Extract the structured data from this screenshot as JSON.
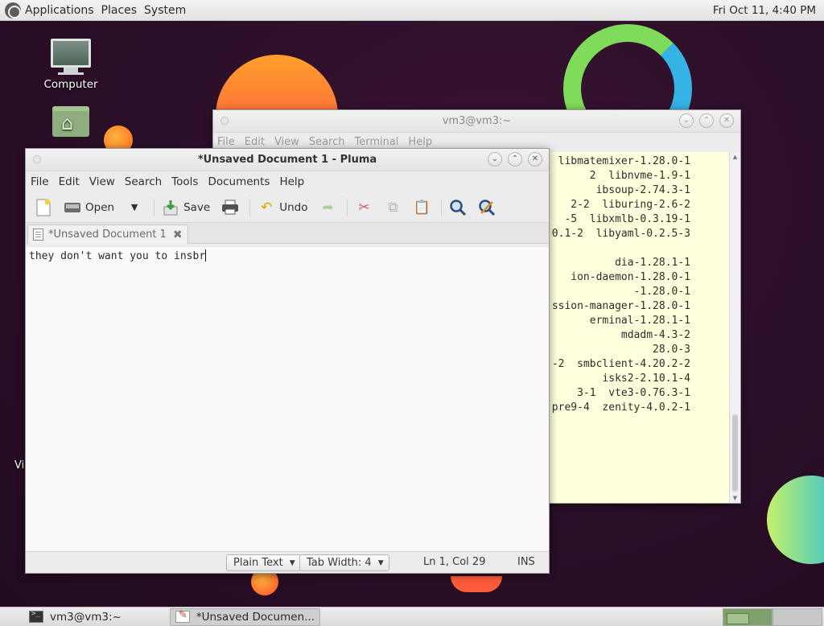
{
  "top_panel": {
    "menus": [
      "Applications",
      "Places",
      "System"
    ],
    "clock": "Fri Oct 11,  4:40 PM"
  },
  "desktop": {
    "icons": [
      {
        "label": "Computer",
        "icon": "computer-icon"
      },
      {
        "label": "",
        "icon": "home-folder-icon"
      }
    ],
    "partial_label": "Vi"
  },
  "terminal": {
    "title": "vm3@vm3:~",
    "menus": [
      "File",
      "Edit",
      "View",
      "Search",
      "Terminal",
      "Help"
    ],
    "lines": [
      "libmatemixer-1.28.0-1",
      "2  libnvme-1.9-1",
      "ibsoup-2.74.3-1",
      "2-2  liburing-2.6-2",
      "-5  libxmlb-0.3.19-1",
      ".0.1-2  libyaml-0.2.5-3",
      "",
      "dia-1.28.1-1",
      "ion-daemon-1.28.0-1",
      "-1.28.0-1",
      "ssion-manager-1.28.0-1",
      "erminal-1.28.1-1",
      "  mdadm-4.3-2",
      "28.0-3",
      "-2  smbclient-4.20.2-2",
      "isks2-2.10.1-4",
      "3-1  vte3-0.76.3-1",
      "0.pre9-4  zenity-4.0.2-1"
    ],
    "background_color": "#ffffdd"
  },
  "pluma": {
    "title": "*Unsaved Document 1 - Pluma",
    "menus": [
      "File",
      "Edit",
      "View",
      "Search",
      "Tools",
      "Documents",
      "Help"
    ],
    "toolbar": {
      "new_icon": "new-document-icon",
      "open_label": "Open",
      "save_label": "Save",
      "print_icon": "print-icon",
      "undo_label": "Undo",
      "redo_icon": "redo-icon",
      "cut_icon": "cut-icon",
      "copy_icon": "copy-icon",
      "paste_icon": "paste-icon",
      "find_icon": "find-icon",
      "replace_icon": "find-replace-icon"
    },
    "tab": {
      "label": "*Unsaved Document 1"
    },
    "editor_text": "they don't want you to insbr",
    "status": {
      "language": "Plain Text",
      "tab_width": "Tab Width:  4",
      "position": "Ln 1, Col 29",
      "mode": "INS"
    }
  },
  "taskbar": {
    "tasks": [
      {
        "label": "vm3@vm3:~",
        "icon": "terminal-icon"
      },
      {
        "label": "*Unsaved Documen...",
        "icon": "text-editor-icon"
      }
    ],
    "workspace_count": 2
  }
}
